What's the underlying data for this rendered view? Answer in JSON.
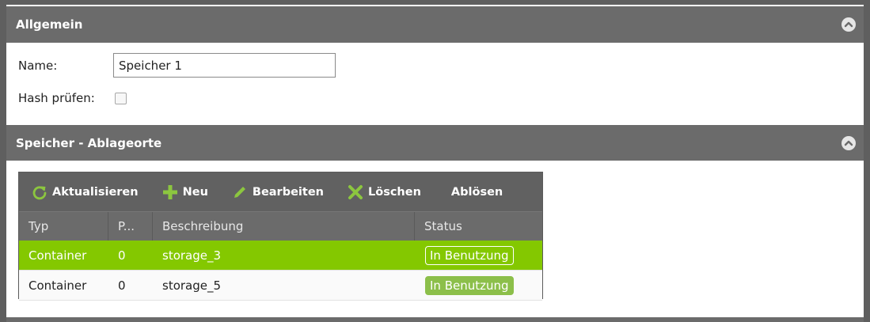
{
  "sections": {
    "general": {
      "title": "Allgemein"
    },
    "locations": {
      "title": "Speicher - Ablageorte"
    }
  },
  "form": {
    "name_label": "Name:",
    "name_value": "Speicher 1",
    "hash_label": "Hash prüfen:",
    "hash_checked": false
  },
  "toolbar": {
    "refresh_label": "Aktualisieren",
    "new_label": "Neu",
    "edit_label": "Bearbeiten",
    "delete_label": "Löschen",
    "replace_label": "Ablösen"
  },
  "table": {
    "columns": [
      "Typ",
      "P...",
      "Beschreibung",
      "Status"
    ],
    "rows": [
      {
        "typ": "Container",
        "p": "0",
        "beschreibung": "storage_3",
        "status": "In Benutzung",
        "selected": true
      },
      {
        "typ": "Container",
        "p": "0",
        "beschreibung": "storage_5",
        "status": "In Benutzung",
        "selected": false
      }
    ]
  },
  "colors": {
    "header_bg": "#6b6b6b",
    "selected_row": "#84c800",
    "icon_green": "#8cc63f"
  }
}
